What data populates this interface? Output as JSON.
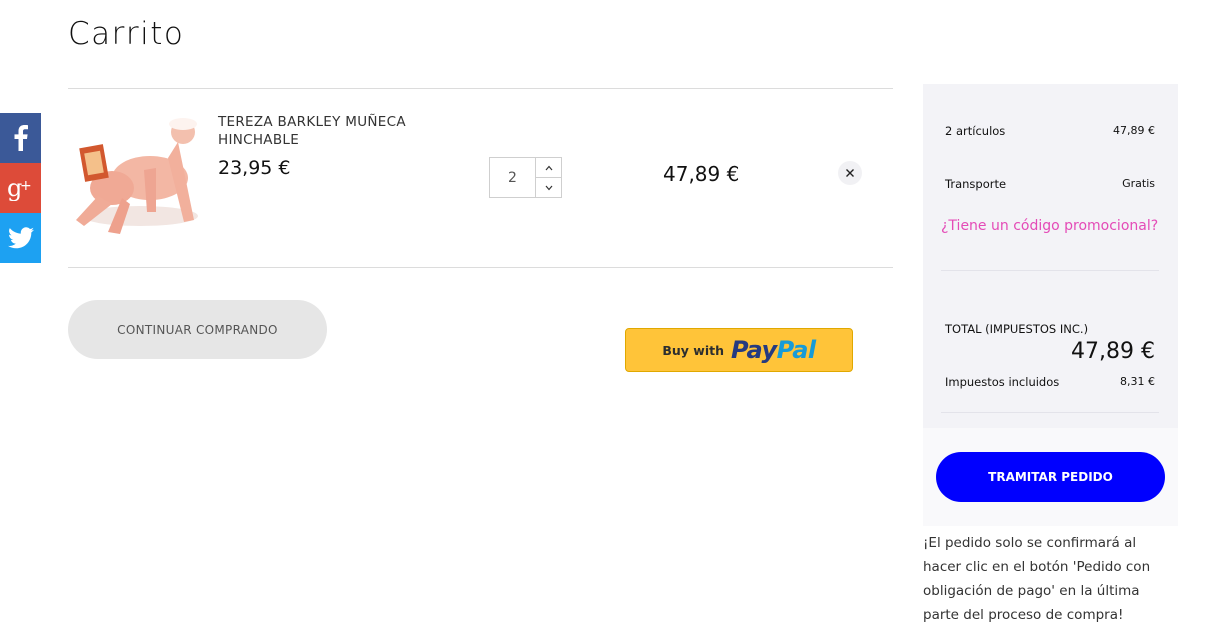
{
  "page": {
    "title": "Carrito"
  },
  "social": [
    {
      "name": "facebook-icon",
      "glyph": "f"
    },
    {
      "name": "google-plus-icon",
      "glyph": "g+"
    },
    {
      "name": "twitter-icon",
      "glyph": "bird"
    }
  ],
  "cart": {
    "items": [
      {
        "name": "TEREZA BARKLEY MUÑECA HINCHABLE",
        "unit_price": "23,95 €",
        "quantity": "2",
        "line_total": "47,89 €"
      }
    ]
  },
  "buttons": {
    "continue": "CONTINUAR COMPRANDO",
    "paypal_prefix": "Buy with",
    "paypal_brand_1": "Pay",
    "paypal_brand_2": "Pal",
    "checkout": "TRAMITAR PEDIDO"
  },
  "summary": {
    "items_label": "2 artículos",
    "items_value": "47,89 €",
    "shipping_label": "Transporte",
    "shipping_value": "Gratis",
    "promo_link": "¿Tiene un código promocional?",
    "total_label": "TOTAL (IMPUESTOS INC.)",
    "total_value": "47,89 €",
    "tax_label": "Impuestos incluidos",
    "tax_value": "8,31 €"
  },
  "notice": "¡El pedido solo se confirmará al hacer clic en el botón 'Pedido con obligación de pago' en la última parte del proceso de compra!",
  "colors": {
    "checkout_button": "#0000ff",
    "promo_link": "#e44bb7",
    "paypal_button": "#ffc439",
    "facebook": "#3b5998",
    "google_plus": "#dd4b39",
    "twitter": "#1da1f2"
  }
}
